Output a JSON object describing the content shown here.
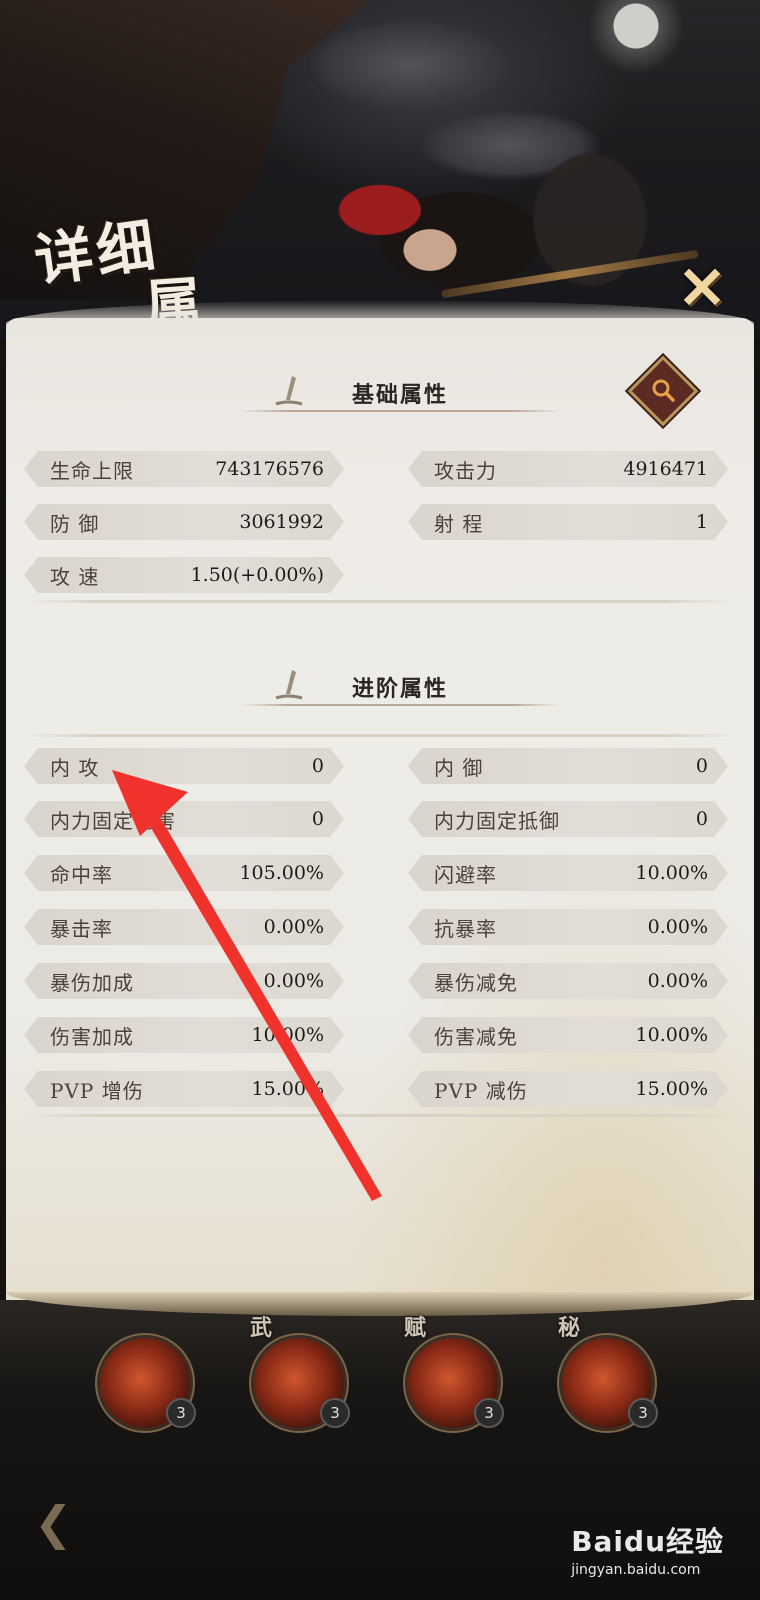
{
  "header": {
    "title_line1": "详细",
    "title_line2": "属性",
    "close_label": "✕"
  },
  "basic": {
    "title": "基础属性",
    "stats": [
      {
        "label": "生命上限",
        "value": "743176576"
      },
      {
        "label": "攻击力",
        "value": "4916471"
      },
      {
        "label": "防  御",
        "value": "3061992"
      },
      {
        "label": "射  程",
        "value": "1"
      },
      {
        "label": "攻  速",
        "value": "1.50(+0.00%)"
      }
    ]
  },
  "advanced": {
    "title": "进阶属性",
    "stats": [
      {
        "label": "内  攻",
        "value": "0"
      },
      {
        "label": "内  御",
        "value": "0"
      },
      {
        "label": "内力固定伤害",
        "value": "0"
      },
      {
        "label": "内力固定抵御",
        "value": "0"
      },
      {
        "label": "命中率",
        "value": "105.00%"
      },
      {
        "label": "闪避率",
        "value": "10.00%"
      },
      {
        "label": "暴击率",
        "value": "0.00%"
      },
      {
        "label": "抗暴率",
        "value": "0.00%"
      },
      {
        "label": "暴伤加成",
        "value": "0.00%"
      },
      {
        "label": "暴伤减免",
        "value": "0.00%"
      },
      {
        "label": "伤害加成",
        "value": "10.00%"
      },
      {
        "label": "伤害减免",
        "value": "10.00%"
      },
      {
        "label": "PVP 增伤",
        "value": "15.00%"
      },
      {
        "label": "PVP 减伤",
        "value": "15.00%"
      }
    ]
  },
  "skills": [
    {
      "tag": "",
      "level": "3"
    },
    {
      "tag": "武",
      "level": "3"
    },
    {
      "tag": "赋",
      "level": "3"
    },
    {
      "tag": "秘",
      "level": "3"
    }
  ],
  "watermark": {
    "main": "Baidu经验",
    "sub": "jingyan.baidu.com"
  },
  "colors": {
    "annotation_arrow": "#f0322d",
    "parchment": "#ecebe6",
    "stat_pill": "#dcd8d0"
  }
}
